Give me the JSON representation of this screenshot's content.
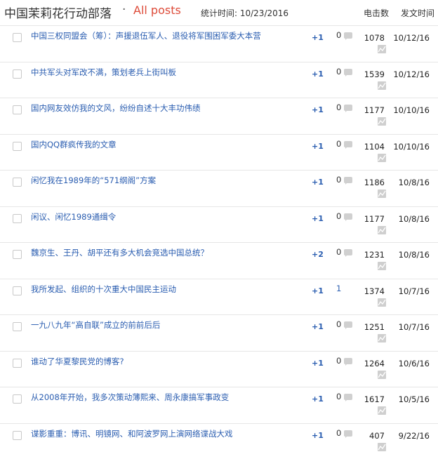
{
  "header": {
    "blog_title": "中国茉莉花行动部落",
    "separator": "·",
    "all_posts": "All posts",
    "stats_label": "统计时间: 10/23/2016",
    "col_clicks": "电击数",
    "col_date": "发文时间"
  },
  "posts": [
    {
      "title": "中国三权同盟会（筹）：声援退伍军人、退役将军围困军委大本营",
      "plus": "+1",
      "comments": "0",
      "clicks": "1078",
      "date": "10/12/16"
    },
    {
      "title": "中共军头对军改不满，策划老兵上街叫板",
      "plus": "+1",
      "comments": "0",
      "clicks": "1539",
      "date": "10/12/16"
    },
    {
      "title": "国内网友效仿我的文风，纷纷自述十大丰功伟绩",
      "plus": "+1",
      "comments": "0",
      "clicks": "1177",
      "date": "10/10/16"
    },
    {
      "title": "国内QQ群疯传我的文章",
      "plus": "+1",
      "comments": "0",
      "clicks": "1104",
      "date": "10/10/16"
    },
    {
      "title": "闲忆我在1989年的“571纲阁”方案",
      "plus": "+1",
      "comments": "0",
      "clicks": "1186",
      "date": "10/8/16"
    },
    {
      "title": "闲议、闲忆1989通缉令",
      "plus": "+1",
      "comments": "0",
      "clicks": "1177",
      "date": "10/8/16"
    },
    {
      "title": "魏京生、王丹、胡平还有多大机会竞选中国总统？",
      "plus": "+2",
      "comments": "0",
      "clicks": "1231",
      "date": "10/8/16"
    },
    {
      "title": "我所发起、组织的十次重大中国民主运动",
      "plus": "+1",
      "comments": "1",
      "clicks": "1374",
      "date": "10/7/16"
    },
    {
      "title": "一九八九年“高自联”成立的前前后后",
      "plus": "+1",
      "comments": "0",
      "clicks": "1251",
      "date": "10/7/16"
    },
    {
      "title": "谁动了华夏黎民党的博客?",
      "plus": "+1",
      "comments": "0",
      "clicks": "1264",
      "date": "10/6/16"
    },
    {
      "title": "从2008年开始，我多次策动薄熙来、周永康搞军事政变",
      "plus": "+1",
      "comments": "0",
      "clicks": "1617",
      "date": "10/5/16"
    },
    {
      "title": "谍影重重：博讯、明镜网、和阿波罗网上演网络谍战大戏",
      "plus": "+1",
      "comments": "0",
      "clicks": "407",
      "date": "9/22/16"
    }
  ]
}
